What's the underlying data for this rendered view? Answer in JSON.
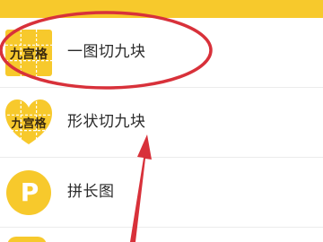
{
  "colors": {
    "brand_yellow": "#f7c92c",
    "annotation_red": "#d8313a",
    "icon_text": "#3a2a10"
  },
  "menu": {
    "items": [
      {
        "label": "一图切九块",
        "icon": "nine-grid-square-icon",
        "icon_text": "九宫格"
      },
      {
        "label": "形状切九块",
        "icon": "nine-grid-heart-icon",
        "icon_text": "九宫格"
      },
      {
        "label": "拼长图",
        "icon": "letter-p-circle-icon",
        "icon_text": "P"
      }
    ]
  },
  "annotation": {
    "ellipse": "highlight-ellipse",
    "arrow": "pointer-arrow"
  }
}
